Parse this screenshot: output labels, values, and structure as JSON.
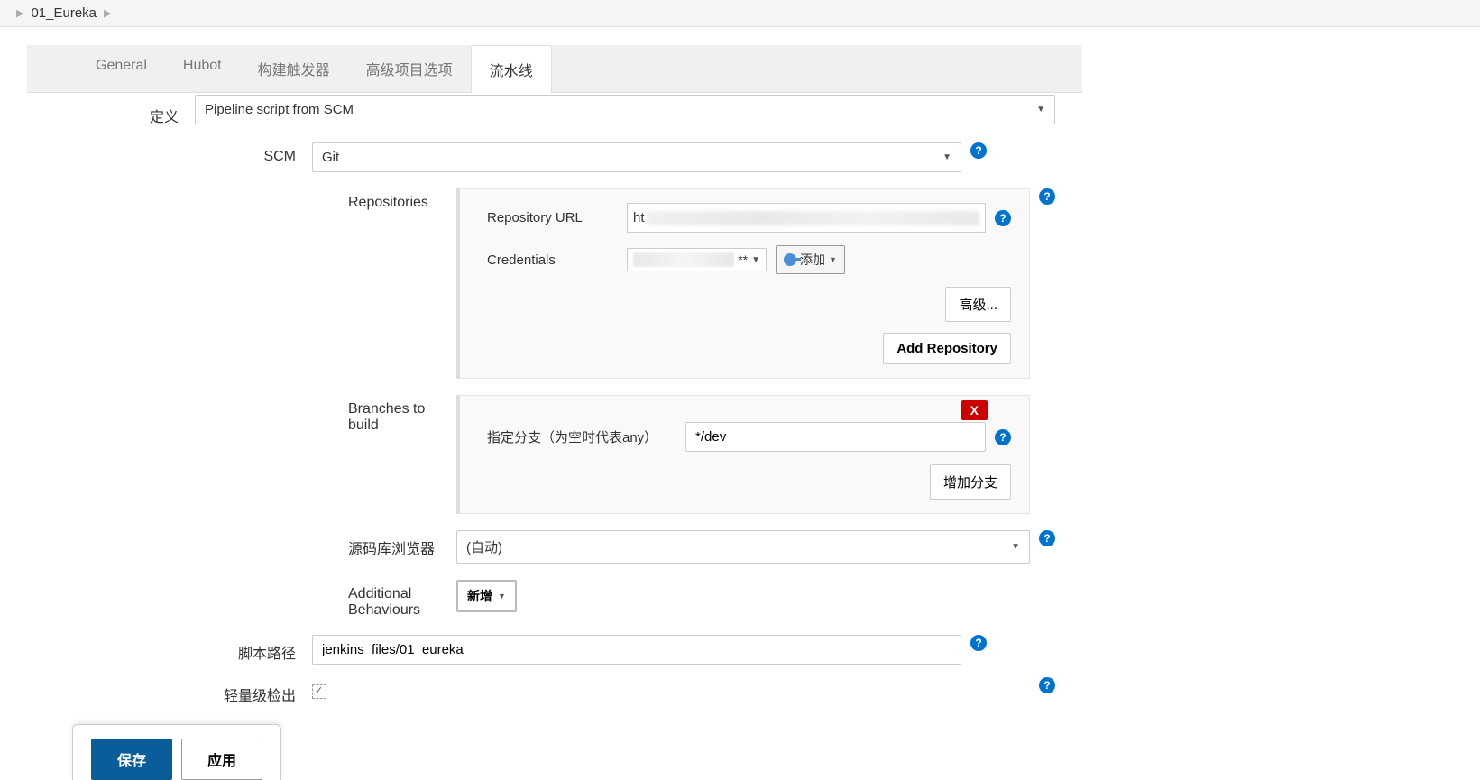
{
  "breadcrumb": {
    "item": "01_Eureka"
  },
  "tabs": {
    "general": "General",
    "hubot": "Hubot",
    "triggers": "构建触发器",
    "advanced": "高级项目选项",
    "pipeline": "流水线"
  },
  "labels": {
    "definition": "定义",
    "scm": "SCM",
    "repositories": "Repositories",
    "repo_url": "Repository URL",
    "credentials": "Credentials",
    "branches": "Branches to build",
    "branch_spec": "指定分支（为空时代表any）",
    "repo_browser": "源码库浏览器",
    "addl_behaviours": "Additional Behaviours",
    "script_path": "脚本路径",
    "lightweight": "轻量级检出"
  },
  "values": {
    "definition": "Pipeline script from SCM",
    "scm": "Git",
    "repo_url_prefix": "ht",
    "cred_suffix": "**",
    "branch": "*/dev",
    "repo_browser": "(自动)",
    "script_path": "jenkins_files/01_eureka"
  },
  "buttons": {
    "add_cred": "添加",
    "advanced": "高级...",
    "add_repository": "Add Repository",
    "add_branch": "增加分支",
    "add_new": "新增",
    "close": "X",
    "save": "保存",
    "apply": "应用"
  }
}
